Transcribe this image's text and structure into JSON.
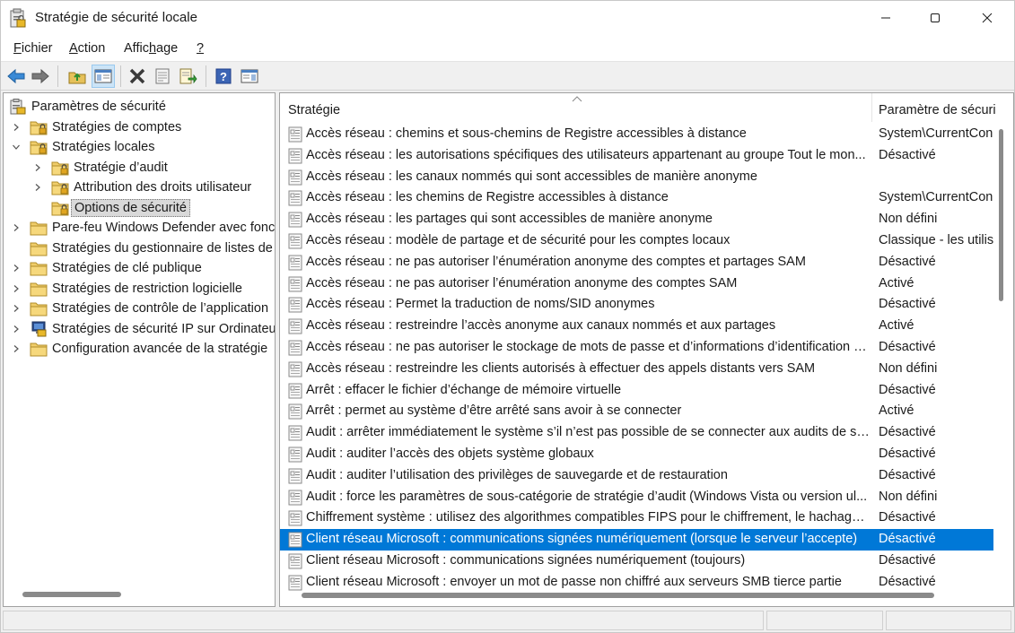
{
  "window": {
    "title": "Stratégie de sécurité locale",
    "accent": "#0078d7"
  },
  "menu": {
    "items": [
      {
        "label": "Fichier",
        "mnemonic": "F"
      },
      {
        "label": "Action",
        "mnemonic": "A"
      },
      {
        "label": "Affichage",
        "mnemonic": "h"
      },
      {
        "label": "?",
        "mnemonic": "?"
      }
    ]
  },
  "toolbar": {
    "buttons": [
      "back-icon",
      "forward-icon",
      "up-folder-icon",
      "show-hide-tree-icon",
      "delete-icon",
      "properties-icon",
      "export-list-icon",
      "help-icon",
      "show-hide-action-pane-icon"
    ]
  },
  "tree": {
    "root": "Paramètres de sécurité",
    "items": [
      {
        "label": "Stratégies de comptes",
        "level": 1,
        "expander": "collapsed",
        "icon": "locked-folder-icon"
      },
      {
        "label": "Stratégies locales",
        "level": 1,
        "expander": "expanded",
        "icon": "locked-folder-icon"
      },
      {
        "label": "Stratégie d’audit",
        "level": 2,
        "expander": "collapsed",
        "icon": "locked-folder-icon"
      },
      {
        "label": "Attribution des droits utilisateur",
        "level": 2,
        "expander": "collapsed",
        "icon": "locked-folder-icon"
      },
      {
        "label": "Options de sécurité",
        "level": 2,
        "expander": "none",
        "icon": "locked-folder-icon",
        "selected": true
      },
      {
        "label": "Pare-feu Windows Defender avec fonc",
        "level": 1,
        "expander": "collapsed",
        "icon": "folder-icon"
      },
      {
        "label": "Stratégies du gestionnaire de listes de",
        "level": 1,
        "expander": "none",
        "icon": "folder-icon"
      },
      {
        "label": "Stratégies de clé publique",
        "level": 1,
        "expander": "collapsed",
        "icon": "folder-icon"
      },
      {
        "label": "Stratégies de restriction logicielle",
        "level": 1,
        "expander": "collapsed",
        "icon": "folder-icon"
      },
      {
        "label": "Stratégies de contrôle de l’application",
        "level": 1,
        "expander": "collapsed",
        "icon": "folder-icon"
      },
      {
        "label": "Stratégies de sécurité IP sur Ordinateu",
        "level": 1,
        "expander": "collapsed",
        "icon": "ip-security-icon"
      },
      {
        "label": "Configuration avancée de la stratégie",
        "level": 1,
        "expander": "collapsed",
        "icon": "folder-icon"
      }
    ]
  },
  "list": {
    "columns": [
      "Stratégie",
      "Paramètre de sécuri"
    ],
    "rows": [
      {
        "policy": "Accès réseau : chemins et sous-chemins de Registre accessibles à distance",
        "value": "System\\CurrentCon"
      },
      {
        "policy": "Accès réseau : les autorisations spécifiques des utilisateurs appartenant au groupe Tout le mon...",
        "value": "Désactivé"
      },
      {
        "policy": "Accès réseau : les canaux nommés qui sont accessibles de manière anonyme",
        "value": ""
      },
      {
        "policy": "Accès réseau : les chemins de Registre accessibles à distance",
        "value": "System\\CurrentCon"
      },
      {
        "policy": "Accès réseau : les partages qui sont accessibles de manière anonyme",
        "value": "Non défini"
      },
      {
        "policy": "Accès réseau : modèle de partage et de sécurité pour les comptes locaux",
        "value": "Classique - les utilis"
      },
      {
        "policy": "Accès réseau : ne pas autoriser l’énumération anonyme des comptes et partages SAM",
        "value": "Désactivé"
      },
      {
        "policy": "Accès réseau : ne pas autoriser l’énumération anonyme des comptes SAM",
        "value": "Activé"
      },
      {
        "policy": "Accès réseau : Permet la traduction de noms/SID anonymes",
        "value": "Désactivé"
      },
      {
        "policy": "Accès réseau : restreindre l’accès anonyme aux canaux nommés et aux partages",
        "value": "Activé"
      },
      {
        "policy": "Accès réseau : ne pas autoriser le stockage de mots de passe et d’informations d’identification p...",
        "value": "Désactivé"
      },
      {
        "policy": "Accès réseau : restreindre les clients autorisés à effectuer des appels distants vers SAM",
        "value": "Non défini"
      },
      {
        "policy": "Arrêt : effacer le fichier d’échange de mémoire virtuelle",
        "value": "Désactivé"
      },
      {
        "policy": "Arrêt : permet au système d’être arrêté sans avoir à se connecter",
        "value": "Activé"
      },
      {
        "policy": "Audit : arrêter immédiatement le système s’il n’est pas possible de se connecter aux audits de sé...",
        "value": "Désactivé"
      },
      {
        "policy": "Audit : auditer l’accès des objets système globaux",
        "value": "Désactivé"
      },
      {
        "policy": "Audit : auditer l’utilisation des privilèges de sauvegarde et de restauration",
        "value": "Désactivé"
      },
      {
        "policy": "Audit : force les paramètres de sous-catégorie de stratégie d’audit (Windows Vista ou version ul...",
        "value": "Non défini"
      },
      {
        "policy": "Chiffrement système : utilisez des algorithmes compatibles FIPS pour le chiffrement, le hachage ...",
        "value": "Désactivé"
      },
      {
        "policy": "Client réseau Microsoft : communications signées numériquement (lorsque le serveur l’accepte)",
        "value": "Désactivé",
        "selected": true
      },
      {
        "policy": "Client réseau Microsoft : communications signées numériquement (toujours)",
        "value": "Désactivé"
      },
      {
        "policy": "Client réseau Microsoft : envoyer un mot de passe non chiffré aux serveurs SMB tierce partie",
        "value": "Désactivé"
      }
    ]
  }
}
